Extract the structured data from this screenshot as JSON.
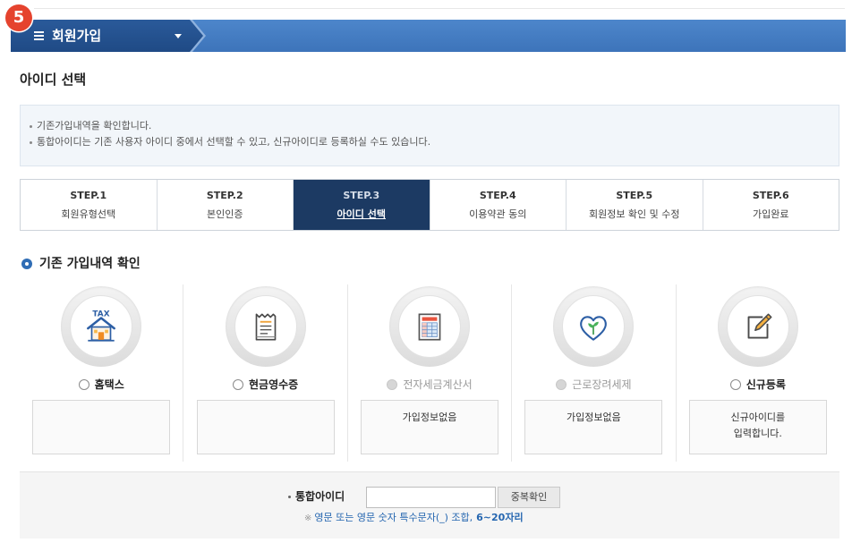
{
  "step_badge": "5",
  "header": {
    "menu_icon": "menu-icon",
    "title": "회원가입",
    "dropdown_icon": "caret-down-icon"
  },
  "page_title": "아이디 선택",
  "info": {
    "lines": [
      "기존가입내역을 확인합니다.",
      "통합아이디는 기존 사용자 아이디 중에서 선택할 수 있고, 신규아이디로 등록하실 수도 있습니다."
    ]
  },
  "steps": [
    {
      "step": "STEP.1",
      "label": "회원유형선택",
      "active": false
    },
    {
      "step": "STEP.2",
      "label": "본인인증",
      "active": false
    },
    {
      "step": "STEP.3",
      "label": "아이디 선택",
      "active": true
    },
    {
      "step": "STEP.4",
      "label": "이용약관 동의",
      "active": false
    },
    {
      "step": "STEP.5",
      "label": "회원정보 확인 및 수정",
      "active": false
    },
    {
      "step": "STEP.6",
      "label": "가입완료",
      "active": false
    }
  ],
  "section": {
    "title": "기존 가입내역 확인"
  },
  "services": [
    {
      "name": "홈택스",
      "icon": "house-tax-icon",
      "icon_text": "TAX",
      "enabled": true,
      "selected": false,
      "box_lines": []
    },
    {
      "name": "현금영수증",
      "icon": "receipt-icon",
      "enabled": true,
      "selected": false,
      "box_lines": []
    },
    {
      "name": "전자세금계산서",
      "icon": "tax-invoice-icon",
      "enabled": false,
      "selected": false,
      "box_lines": [
        "가입정보없음"
      ]
    },
    {
      "name": "근로장려세제",
      "icon": "heart-sprout-icon",
      "enabled": false,
      "selected": false,
      "box_lines": [
        "가입정보없음"
      ]
    },
    {
      "name": "신규등록",
      "icon": "edit-icon",
      "enabled": true,
      "selected": false,
      "box_lines": [
        "신규아이디를",
        "입력합니다."
      ]
    }
  ],
  "id_form": {
    "label": "통합아이디",
    "value": "",
    "check_button": "중복확인",
    "note_mark": "※",
    "note": "영문 또는 영문 숫자 특수문자(_) 조합,",
    "note_emphasis": "6~20자리"
  },
  "colors": {
    "header_dark": "#1f4a85",
    "header_light": "#3d74ba",
    "active_step": "#1c3a63",
    "badge": "#e5432e",
    "note_text": "#2566b0",
    "section_bullet": "#2f6db5"
  }
}
